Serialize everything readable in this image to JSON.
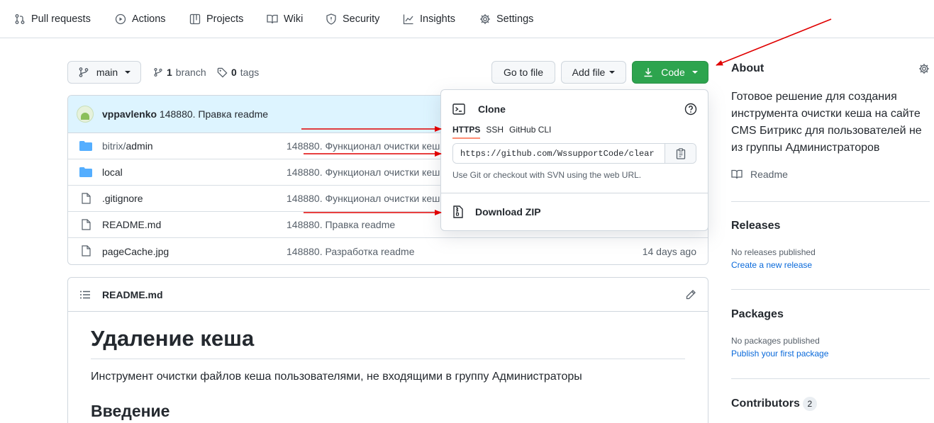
{
  "nav": {
    "pull_requests": "Pull requests",
    "actions": "Actions",
    "projects": "Projects",
    "wiki": "Wiki",
    "security": "Security",
    "insights": "Insights",
    "settings": "Settings"
  },
  "branch_bar": {
    "branch": "main",
    "branch_count": "1",
    "branch_word": "branch",
    "tag_count": "0",
    "tag_word": "tags",
    "go_to_file": "Go to file",
    "add_file": "Add file",
    "code": "Code"
  },
  "commit": {
    "author": "vppavlenko",
    "message": "148880. Правка readme"
  },
  "files": [
    {
      "prefix": "bitrix/",
      "name": "admin",
      "type": "folder",
      "message": "148880. Функционал очистки кеша",
      "age": ""
    },
    {
      "prefix": "",
      "name": "local",
      "type": "folder",
      "message": "148880. Функционал очистки кеша",
      "age": ""
    },
    {
      "prefix": "",
      "name": ".gitignore",
      "type": "file",
      "message": "148880. Функционал очистки кеша",
      "age": ""
    },
    {
      "prefix": "",
      "name": "README.md",
      "type": "file",
      "message": "148880. Правка readme",
      "age": ""
    },
    {
      "prefix": "",
      "name": "pageCache.jpg",
      "type": "file",
      "message": "148880. Разработка readme",
      "age": "14 days ago"
    }
  ],
  "readme": {
    "filename": "README.md",
    "h1": "Удаление кеша",
    "paragraph": "Инструмент очистки файлов кеша пользователями, не входящими в группу Администраторы",
    "h2": "Введение"
  },
  "clone": {
    "title": "Clone",
    "tabs": [
      "HTTPS",
      "SSH",
      "GitHub CLI"
    ],
    "url": "https://github.com/WssupportCode/clear",
    "hint": "Use Git or checkout with SVN using the web URL.",
    "download_zip": "Download ZIP"
  },
  "sidebar": {
    "about_title": "About",
    "description": "Готовое решение для создания инструмента очистки кеша на сайте CMS Битрикс для пользователей не из группы Администраторов",
    "readme_link": "Readme",
    "releases_title": "Releases",
    "releases_none": "No releases published",
    "releases_link": "Create a new release",
    "packages_title": "Packages",
    "packages_none": "No packages published",
    "packages_link": "Publish your first package",
    "contributors_title": "Contributors",
    "contributors_count": "2"
  },
  "colors": {
    "accent_green": "#2da44e",
    "link_blue": "#0969da",
    "annotation_red": "#e00000",
    "commit_bg": "#ddf4ff",
    "folder_blue": "#54aeff"
  }
}
